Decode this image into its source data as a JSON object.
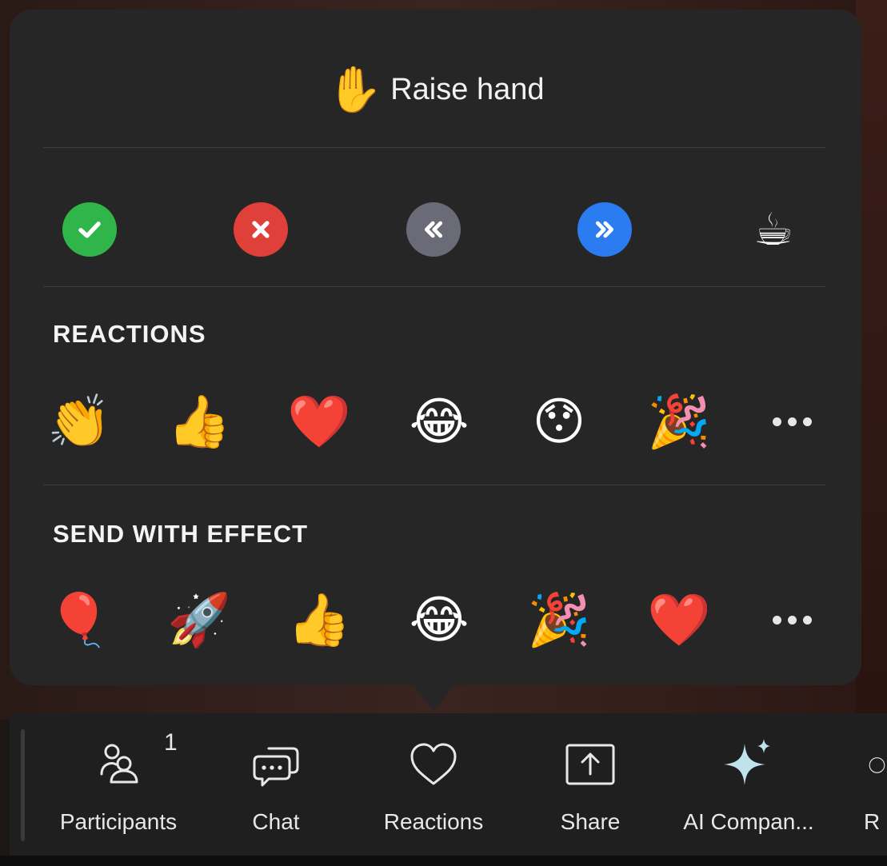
{
  "popup": {
    "raise_hand": {
      "emoji": "✋",
      "label": "Raise hand"
    },
    "status_buttons": [
      {
        "name": "yes",
        "icon": "check-icon",
        "color": "#2fb54a"
      },
      {
        "name": "no",
        "icon": "x-icon",
        "color": "#e0403a"
      },
      {
        "name": "slower",
        "icon": "double-left-chevron-icon",
        "color": "#6b6b78"
      },
      {
        "name": "faster",
        "icon": "double-right-chevron-icon",
        "color": "#2b7cf0"
      },
      {
        "name": "coffee",
        "icon": "coffee-icon",
        "emoji": "☕"
      }
    ],
    "reactions_title": "REACTIONS",
    "reactions": [
      "👏",
      "👍",
      "❤️",
      "😂",
      "😯",
      "🎉"
    ],
    "effects_title": "SEND WITH EFFECT",
    "effects": [
      "🎈",
      "🚀",
      "👍",
      "😂",
      "🎉",
      "❤️"
    ]
  },
  "toolbar": {
    "participants_label": "Participants",
    "participants_count": "1",
    "chat_label": "Chat",
    "reactions_label": "Reactions",
    "share_label": "Share",
    "ai_label": "AI Compan...",
    "cut_label": "R"
  }
}
